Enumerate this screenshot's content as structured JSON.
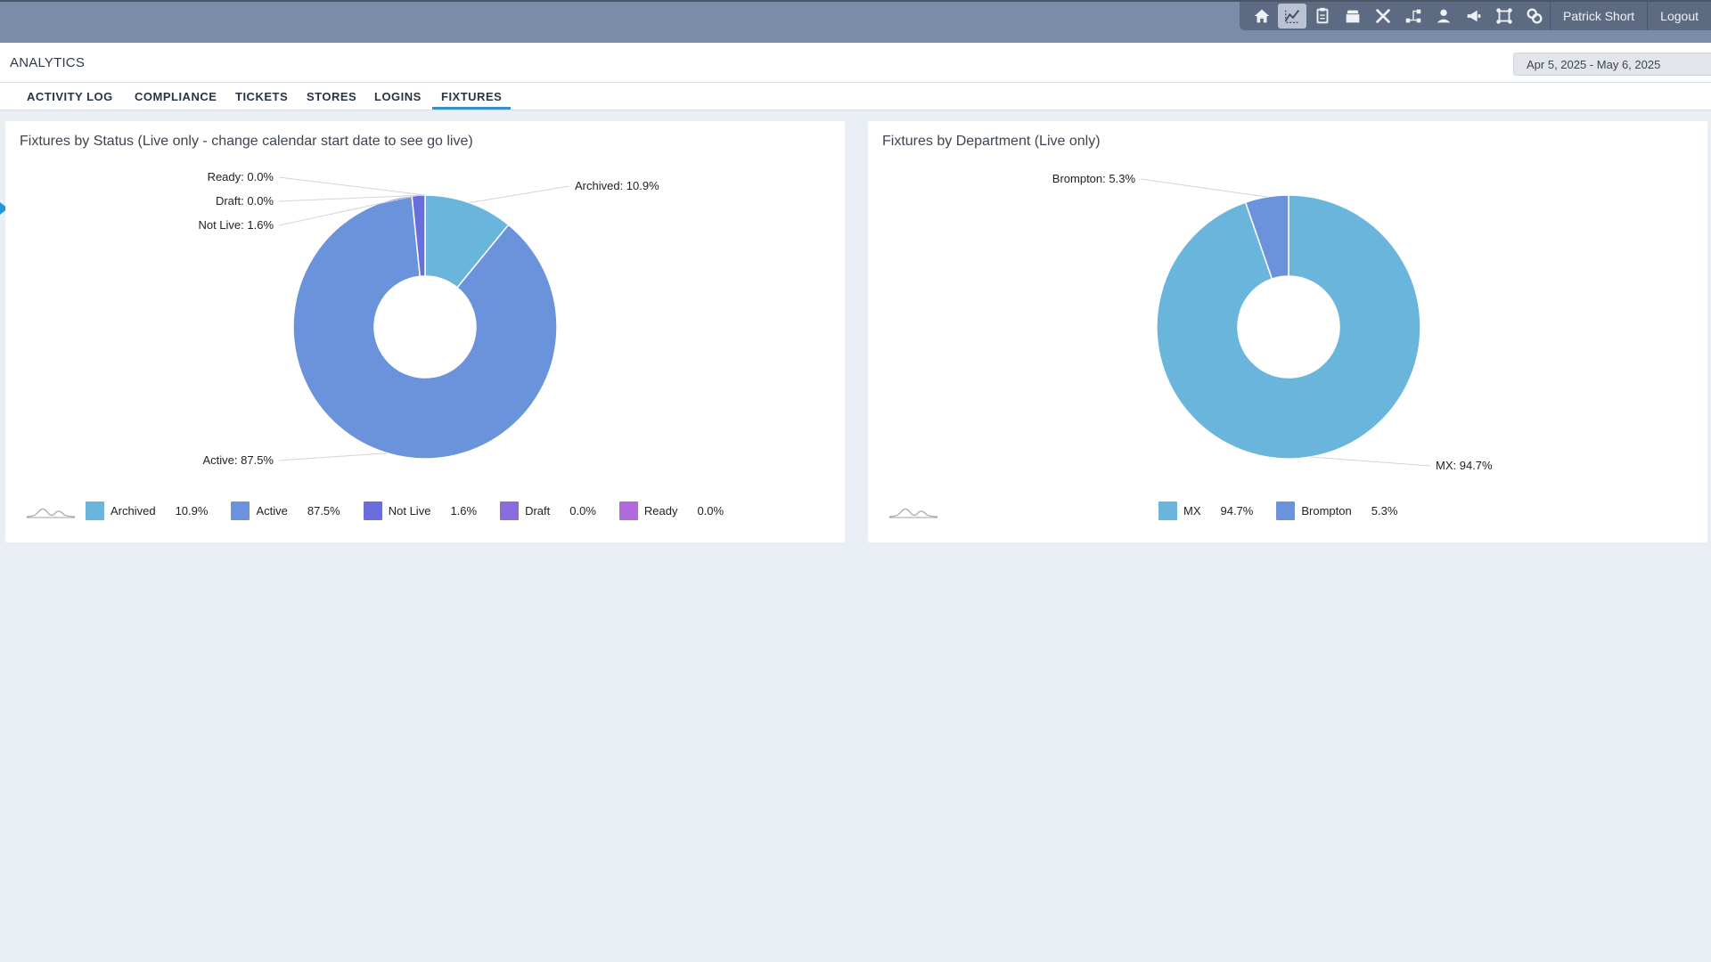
{
  "app": {
    "user_name": "Patrick Short",
    "logout_label": "Logout",
    "toolbar_icons": [
      "home-icon",
      "analytics-icon",
      "clipboard-icon",
      "tray-icon",
      "tools-icon",
      "hierarchy-icon",
      "support-icon",
      "megaphone-icon",
      "fixture-icon",
      "link-icon"
    ]
  },
  "header": {
    "title": "ANALYTICS",
    "date_range": "Apr 5, 2025 - May 6, 2025"
  },
  "tabs": [
    {
      "label": "ACTIVITY LOG",
      "active": false
    },
    {
      "label": "COMPLIANCE",
      "active": false
    },
    {
      "label": "TICKETS",
      "active": false
    },
    {
      "label": "STORES",
      "active": false
    },
    {
      "label": "LOGINS",
      "active": false
    },
    {
      "label": "FIXTURES",
      "active": true
    }
  ],
  "cards": [
    {
      "title": "Fixtures by Status (Live only - change calendar start date to see go live)",
      "legend": [
        {
          "name": "Archived",
          "value": "10.9%"
        },
        {
          "name": "Active",
          "value": "87.5%"
        },
        {
          "name": "Not Live",
          "value": "1.6%"
        },
        {
          "name": "Draft",
          "value": "0.0%"
        },
        {
          "name": "Ready",
          "value": "0.0%"
        }
      ]
    },
    {
      "title": "Fixtures by Department (Live only)",
      "legend": [
        {
          "name": "MX",
          "value": "94.7%"
        },
        {
          "name": "Brompton",
          "value": "5.3%"
        }
      ]
    }
  ],
  "chart_data": [
    {
      "type": "pie",
      "title": "Fixtures by Status (Live only - change calendar start date to see go live)",
      "categories": [
        "Archived",
        "Active",
        "Not Live",
        "Draft",
        "Ready"
      ],
      "values": [
        10.9,
        87.5,
        1.6,
        0.0,
        0.0
      ],
      "labels": [
        "Archived: 10.9%",
        "Active: 87.5%",
        "Not Live: 1.6%",
        "Draft: 0.0%",
        "Ready: 0.0%"
      ],
      "colors": [
        "#6ab5dc",
        "#6a93dc",
        "#6a6edc",
        "#8a6adc",
        "#b06adc"
      ],
      "donut": true,
      "legend": "bottom"
    },
    {
      "type": "pie",
      "title": "Fixtures by Department (Live only)",
      "categories": [
        "MX",
        "Brompton"
      ],
      "values": [
        94.7,
        5.3
      ],
      "labels": [
        "MX: 94.7%",
        "Brompton: 5.3%"
      ],
      "colors": [
        "#6ab5dc",
        "#6a93dc"
      ],
      "donut": true,
      "legend": "bottom"
    }
  ]
}
